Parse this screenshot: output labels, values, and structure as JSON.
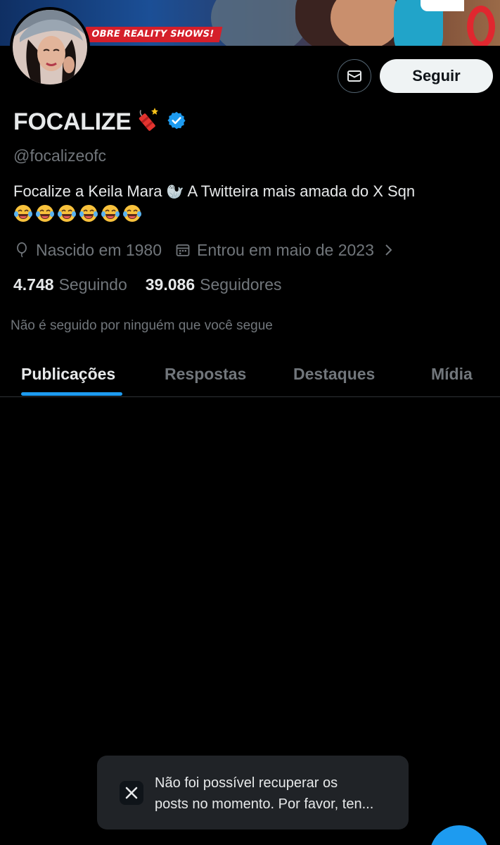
{
  "banner": {
    "tag_text": "OBRE REALITY SHOWS!"
  },
  "profile": {
    "display_name": "FOCALIZE",
    "handle": "@focalizeofc",
    "bio_text": "Focalize a Keila Mara",
    "bio_emoji_seal": "🦭",
    "bio_text_2": " A Twitteira mais amada do X Sqn",
    "bio_laugh_emoji_count": 6,
    "birth": "Nascido em 1980",
    "joined": "Entrou em maio de 2023",
    "following_count": "4.748",
    "following_label": "Seguindo",
    "followers_count": "39.086",
    "followers_label": "Seguidores",
    "not_followed_text": "Não é seguido por ninguém que você segue"
  },
  "actions": {
    "follow_label": "Seguir"
  },
  "tabs": [
    {
      "label": "Publicações",
      "active": true
    },
    {
      "label": "Respostas",
      "active": false
    },
    {
      "label": "Destaques",
      "active": false
    },
    {
      "label": "Mídia",
      "active": false
    }
  ],
  "toast": {
    "line1": "Não foi possível recuperar os",
    "line2": "posts no momento. Por favor, ten..."
  },
  "colors": {
    "accent": "#1d9bf0",
    "background": "#000000",
    "secondary_text": "#71767b"
  }
}
